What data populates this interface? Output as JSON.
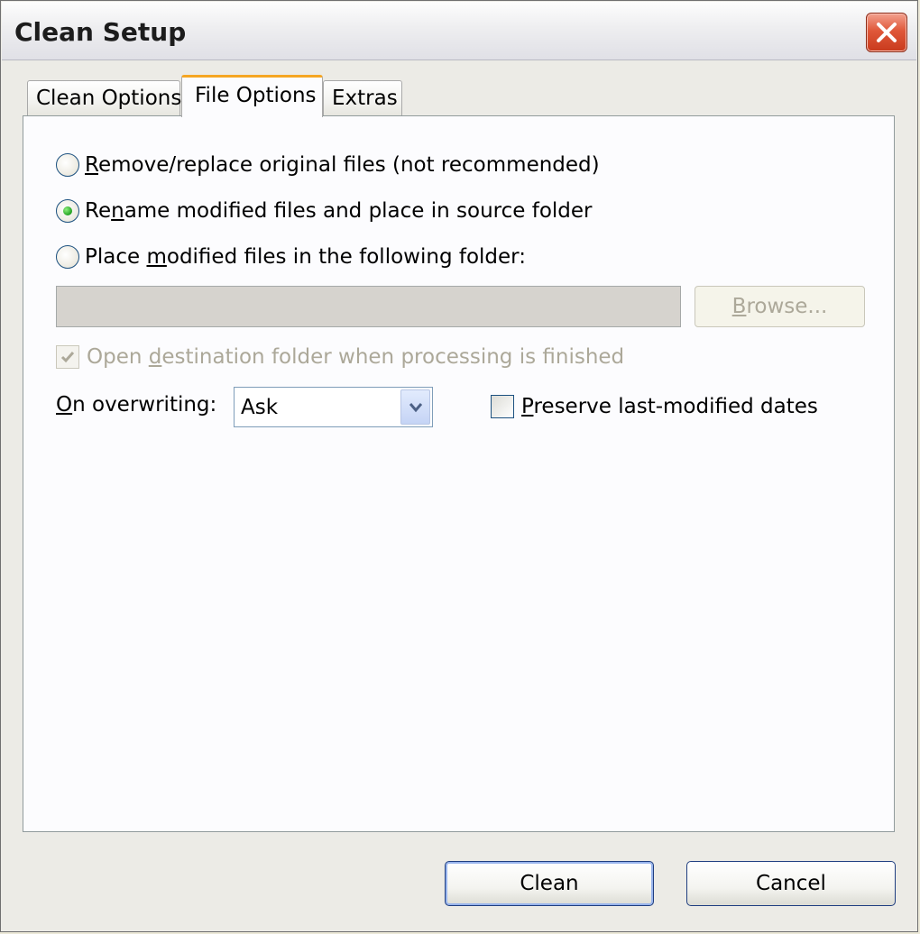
{
  "window": {
    "title": "Clean Setup"
  },
  "tabs": [
    {
      "label": "Clean Options",
      "active": false
    },
    {
      "label": "File Options",
      "active": true
    },
    {
      "label": "Extras",
      "active": false
    }
  ],
  "file_options": {
    "radio_remove": {
      "mn": "R",
      "rest": "emove/replace original files (not recommended)",
      "checked": false
    },
    "radio_rename": {
      "pre": "Re",
      "mn": "n",
      "rest": "ame modified files and place in source folder",
      "checked": true
    },
    "radio_place": {
      "pre": "Place ",
      "mn": "m",
      "rest": "odified files in the following folder:",
      "checked": false
    },
    "folder_value": "",
    "browse": {
      "mn": "B",
      "rest": "rowse..."
    },
    "open_destination": {
      "pre": "Open ",
      "mn": "d",
      "rest": "estination folder when processing is finished",
      "checked": true,
      "disabled": true
    },
    "overwrite": {
      "mn": "O",
      "rest": "n overwriting:",
      "selected": "Ask"
    },
    "preserve": {
      "mn": "P",
      "rest": "reserve last-modified dates",
      "checked": false
    }
  },
  "buttons": {
    "clean": "Clean",
    "cancel": "Cancel"
  },
  "colors": {
    "accent_tab": "#f5a623",
    "radio_dot": "#21a121",
    "close_red": "#e0583a"
  }
}
